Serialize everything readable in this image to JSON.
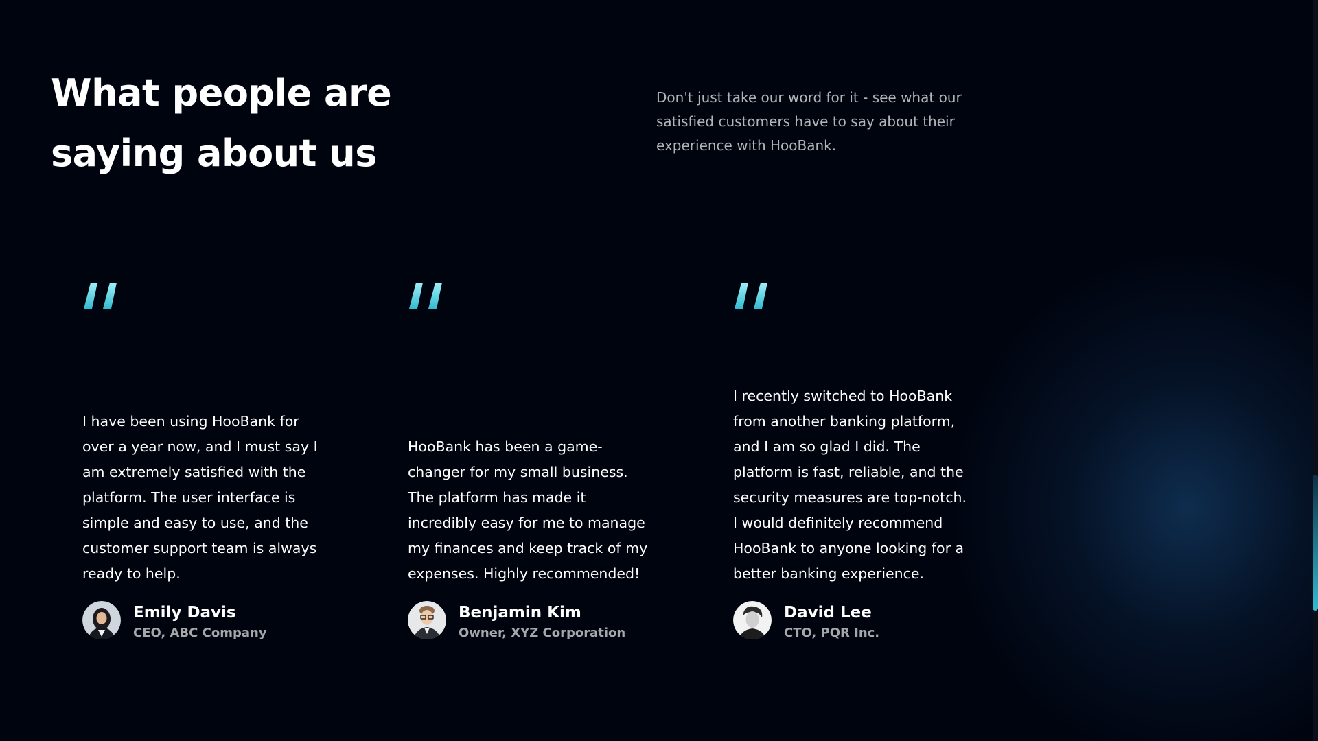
{
  "section": {
    "heading": "What people are saying about us",
    "subtext": "Don't just take our word for it - see what our satisfied customers have to say about their experience with HooBank."
  },
  "testimonials": [
    {
      "quote": "I have been using HooBank for over a year now, and I must say I am extremely satisfied with the platform. The user interface is simple and easy to use, and the customer support team is always ready to help.",
      "name": "Emily Davis",
      "title": "CEO, ABC Company"
    },
    {
      "quote": "HooBank has been a game-changer for my small business. The platform has made it incredibly easy for me to manage my finances and keep track of my expenses. Highly recommended!",
      "name": "Benjamin Kim",
      "title": "Owner, XYZ Corporation"
    },
    {
      "quote": "I recently switched to HooBank from another banking platform, and I am so glad I did. The platform is fast, reliable, and the security measures are top-notch. I would definitely recommend HooBank to anyone looking for a better banking experience.",
      "name": "David Lee",
      "title": "CTO, PQR Inc."
    }
  ],
  "colors": {
    "background": "#00040f",
    "accent_gradient_start": "#9ef0f8",
    "accent_gradient_end": "#33bbcf"
  },
  "icons": {
    "quote": "quote-icon"
  }
}
